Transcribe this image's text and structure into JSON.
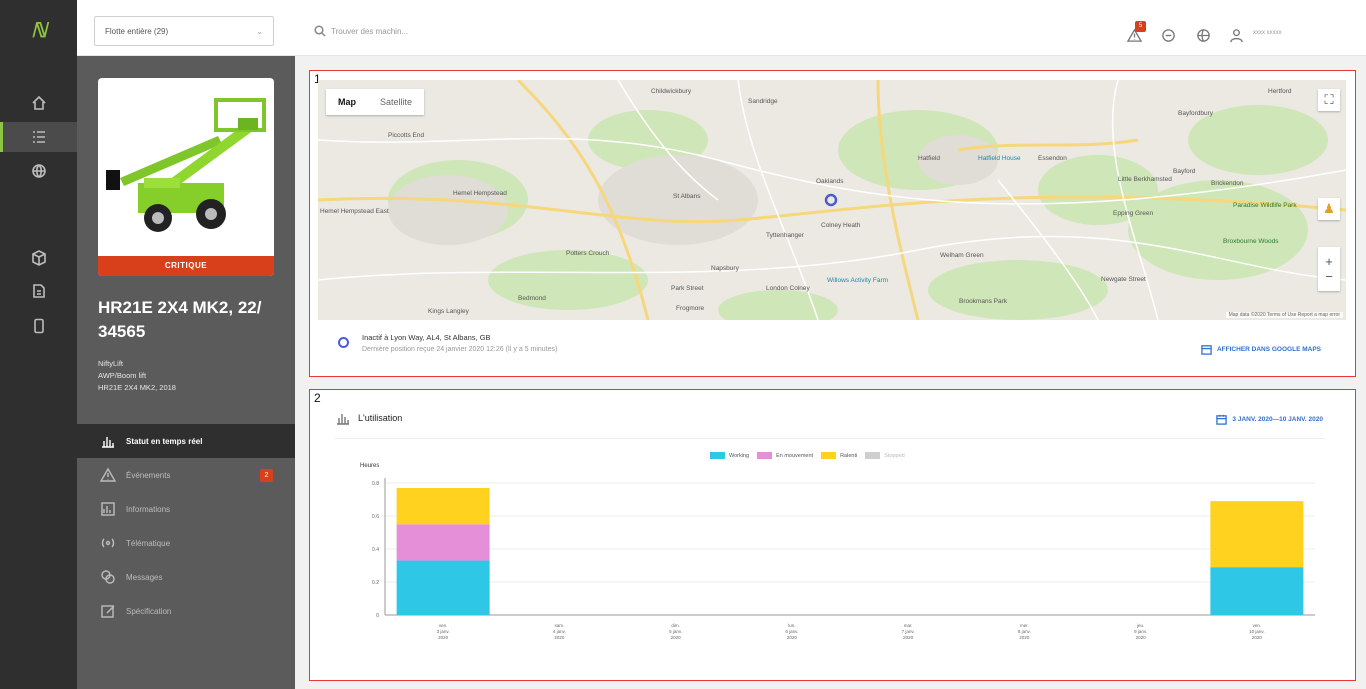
{
  "topbar": {
    "fleet_select": "Flotte entière (29)",
    "search_placeholder": "Trouver des machin...",
    "notification_count": "5",
    "user_name": "xxxx xxxxx"
  },
  "machine": {
    "status": "CRITIQUE",
    "title": "HR21E 2X4 MK2, 22/ 34565",
    "meta": [
      "NiftyLift",
      "AWP/Boom lift",
      "HR21E 2X4 MK2, 2018"
    ]
  },
  "menu": [
    {
      "label": "Statut en temps réel",
      "icon": "chart-icon",
      "active": true
    },
    {
      "label": "Événements",
      "icon": "warning-icon",
      "badge": "2"
    },
    {
      "label": "Informations",
      "icon": "info-chart-icon"
    },
    {
      "label": "Télématique",
      "icon": "signal-icon"
    },
    {
      "label": "Messages",
      "icon": "messages-icon"
    },
    {
      "label": "Spécification",
      "icon": "edit-icon"
    }
  ],
  "map_panel": {
    "number": "1",
    "tabs": [
      "Map",
      "Satellite"
    ],
    "places": [
      "Childwickbury",
      "Sandridge",
      "Hertford",
      "Bayfordbury",
      "Piccotts End",
      "Hatfield",
      "Hatfield House",
      "Essendon",
      "Little Berkhamsted",
      "Bayford",
      "Brickendon",
      "Hemel Hempstead",
      "St Albans",
      "Oaklands",
      "Epping Green",
      "Paradise Wildlife Park",
      "Broxbourne Woods",
      "Potters Crouch",
      "Tyttenhanger",
      "Colney Heath",
      "Welham Green",
      "Napsbury",
      "Park Street",
      "London Colney",
      "Willows Activity Farm",
      "Newgate Street",
      "Bedmond",
      "Frogmore",
      "Brookmans Park",
      "Kings Langley",
      "Hemel Hempstead East"
    ],
    "attribution": "Map data ©2020   Terms of Use   Report a map error",
    "address": "Inactif à Lyon Way, AL4, St Albans, GB",
    "last_position": "Dernière position reçue 24 janvier 2020 12:26 (Il y a 5 minutes)",
    "gmaps_link": "AFFICHER DANS GOOGLE MAPS"
  },
  "usage_panel": {
    "number": "2",
    "title": "L'utilisation",
    "date_range": "3 JANV. 2020—10 JANV. 2020"
  },
  "chart_data": {
    "type": "bar",
    "stacked": true,
    "ylabel": "Heures",
    "ylim": [
      0,
      0.8
    ],
    "yticks": [
      "0",
      "0.2",
      "0.4",
      "0.6",
      "0.8"
    ],
    "categories": [
      [
        "ven.",
        "3 janv.",
        "2020"
      ],
      [
        "sam.",
        "4 janv.",
        "2020"
      ],
      [
        "dim.",
        "5 janv.",
        "2020"
      ],
      [
        "lun.",
        "6 janv.",
        "2020"
      ],
      [
        "mar.",
        "7 janv.",
        "2020"
      ],
      [
        "mer.",
        "8 janv.",
        "2020"
      ],
      [
        "jeu.",
        "9 janv.",
        "2020"
      ],
      [
        "ven.",
        "10 janv.",
        "2020"
      ]
    ],
    "series": [
      {
        "name": "Working",
        "color": "#2ec8e6",
        "values": [
          0.33,
          0,
          0,
          0,
          0,
          0,
          0,
          0.29
        ]
      },
      {
        "name": "En mouvement",
        "color": "#e58fd9",
        "values": [
          0.22,
          0,
          0,
          0,
          0,
          0,
          0,
          0
        ]
      },
      {
        "name": "Ralenti",
        "color": "#ffd21f",
        "values": [
          0.22,
          0,
          0,
          0,
          0,
          0,
          0,
          0.4
        ]
      },
      {
        "name": "Stopped",
        "color": "#cfcfcf",
        "values": [
          0,
          0,
          0,
          0,
          0,
          0,
          0,
          0
        ],
        "hidden": true
      }
    ],
    "legend": "top-center",
    "grid": true
  }
}
